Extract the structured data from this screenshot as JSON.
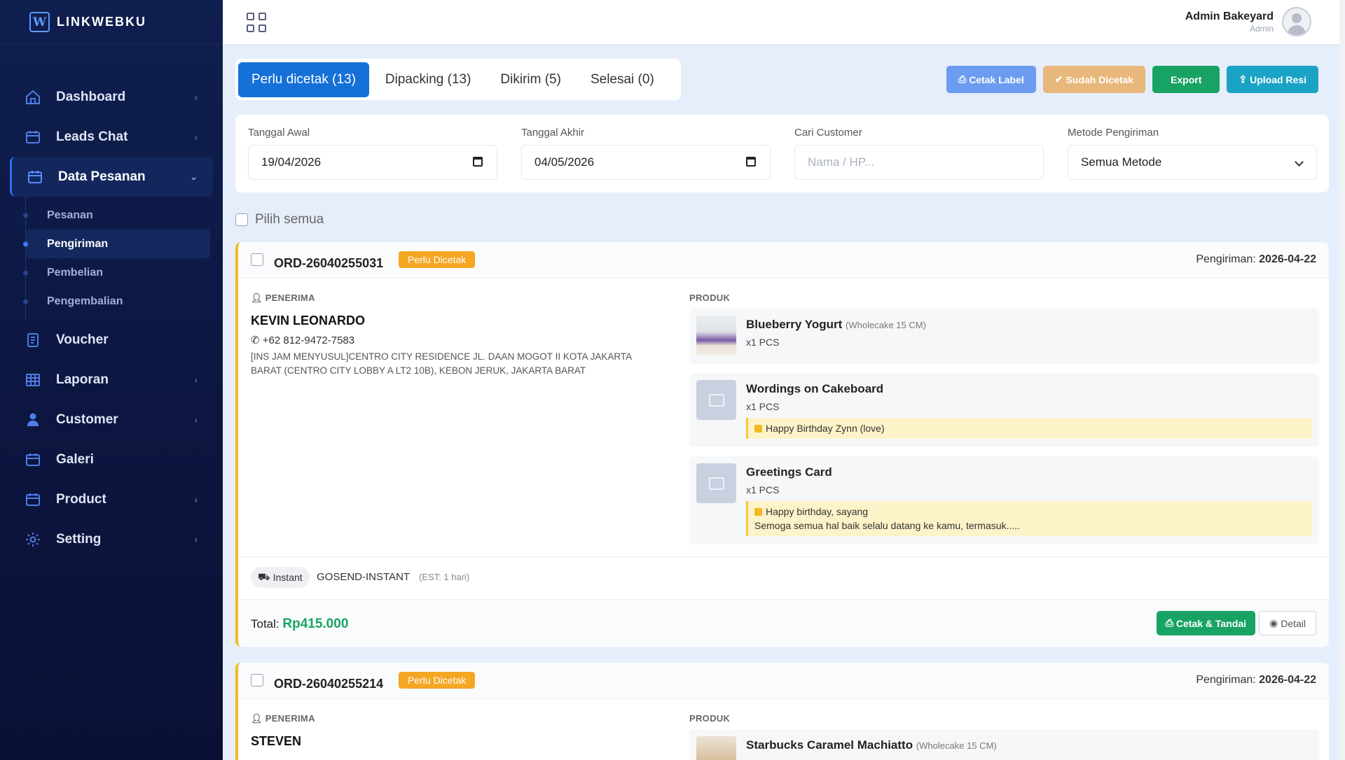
{
  "brand": {
    "name": "LINKWEBKU",
    "logo_letter": "W"
  },
  "sidebar": {
    "items": [
      {
        "label": "Dashboard",
        "icon": "home-icon",
        "has_chevron": true
      },
      {
        "label": "Leads Chat",
        "icon": "chat-icon",
        "has_chevron": true
      },
      {
        "label": "Data Pesanan",
        "icon": "box-icon",
        "has_chevron": true,
        "active": true
      },
      {
        "label": "Voucher",
        "icon": "voucher-icon",
        "has_chevron": false
      },
      {
        "label": "Laporan",
        "icon": "table-icon",
        "has_chevron": true
      },
      {
        "label": "Customer",
        "icon": "user-icon",
        "has_chevron": true
      },
      {
        "label": "Galeri",
        "icon": "gallery-icon",
        "has_chevron": false
      },
      {
        "label": "Product",
        "icon": "product-icon",
        "has_chevron": true
      },
      {
        "label": "Setting",
        "icon": "gear-icon",
        "has_chevron": true
      }
    ],
    "subitems": [
      {
        "label": "Pesanan"
      },
      {
        "label": "Pengiriman",
        "active": true
      },
      {
        "label": "Pembelian"
      },
      {
        "label": "Pengembalian"
      }
    ]
  },
  "topbar": {
    "user_name": "Admin Bakeyard",
    "user_role": "Admin"
  },
  "tabs": [
    {
      "label": "Perlu dicetak (13)",
      "active": true
    },
    {
      "label": "Dipacking (13)"
    },
    {
      "label": "Dikirim (5)"
    },
    {
      "label": "Selesai (0)"
    }
  ],
  "actions": {
    "cetak_label": "Cetak Label",
    "sudah_dicetak": "Sudah Dicetak",
    "export": "Export",
    "upload_resi": "Upload Resi"
  },
  "filters": {
    "tanggal_awal_label": "Tanggal Awal",
    "tanggal_awal_value": "19/04/2026",
    "tanggal_akhir_label": "Tanggal Akhir",
    "tanggal_akhir_value": "04/05/2026",
    "customer_label": "Cari Customer",
    "customer_placeholder": "Nama / HP...",
    "metode_label": "Metode Pengiriman",
    "metode_value": "Semua Metode"
  },
  "select_all": "Pilih semua",
  "labels": {
    "penerima": "PENERIMA",
    "produk": "PRODUK",
    "pengiriman": "Pengiriman:",
    "total": "Total:",
    "cetak_tandai": "Cetak & Tandai",
    "detail": "Detail"
  },
  "orders": [
    {
      "id": "ORD-26040255031",
      "badge": "Perlu Dicetak",
      "ship_date": "2026-04-22",
      "recipient_name": "KEVIN LEONARDO",
      "phone": "+62 812-9472-7583",
      "address": " [INS JAM MENYUSUL]CENTRO CITY RESIDENCE JL. DAAN MOGOT II KOTA JAKARTA BARAT (CENTRO CITY LOBBY A LT2 10B), KEBON JERUK, JAKARTA BARAT",
      "products": [
        {
          "name": "Blueberry Yogurt",
          "variant": "(Wholecake 15 CM)",
          "qty": "x1 PCS",
          "note": ""
        },
        {
          "name": "Wordings on Cakeboard",
          "variant": "",
          "qty": "x1 PCS",
          "note": "Happy Birthday Zynn (love)"
        },
        {
          "name": "Greetings Card",
          "variant": "",
          "qty": "x1 PCS",
          "note": "Happy birthday, sayang",
          "note2": "Semoga semua hal baik selalu datang ke kamu, termasuk....."
        }
      ],
      "ship_type": "Instant",
      "ship_code": "GOSEND-INSTANT",
      "ship_est": "(EST: 1 hari)",
      "total": "Rp415.000"
    },
    {
      "id": "ORD-26040255214",
      "badge": "Perlu Dicetak",
      "ship_date": "2026-04-22",
      "recipient_name": "STEVEN",
      "products": [
        {
          "name": "Starbucks Caramel Machiatto",
          "variant": "(Wholecake 15 CM)"
        }
      ]
    }
  ],
  "colors": {
    "primary": "#1570d8",
    "success": "#18a364",
    "badge": "#f5a623",
    "sidebar_bg": "#0c1640"
  }
}
